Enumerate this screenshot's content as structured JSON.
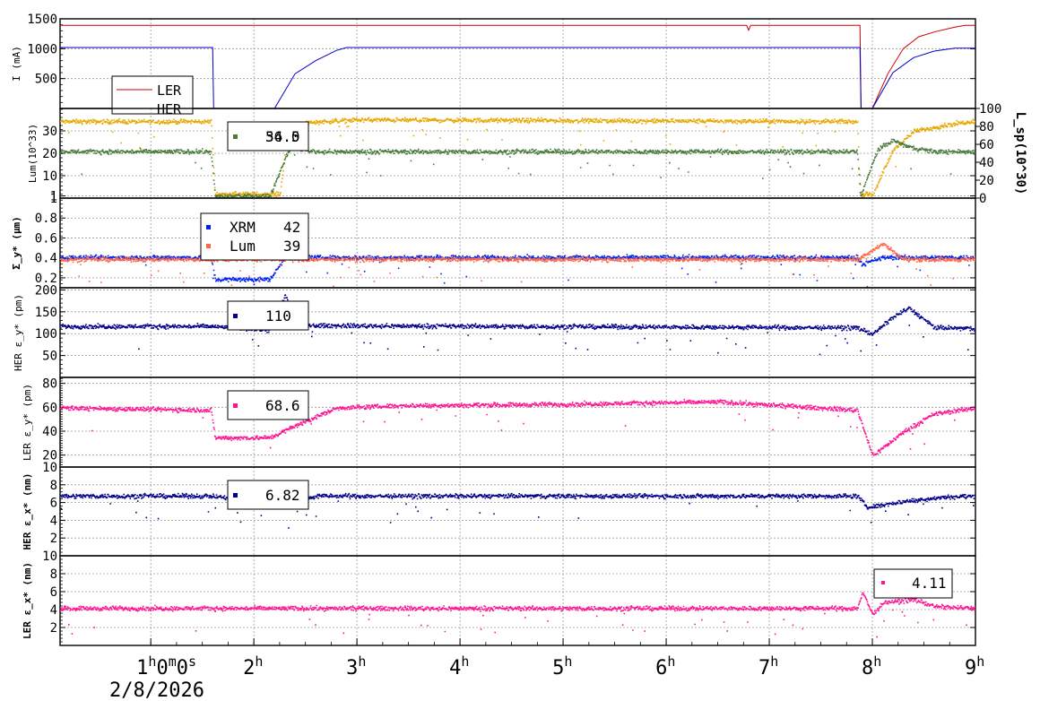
{
  "date_label": "2/8/2026",
  "time_axis": {
    "range_hours": [
      0.12,
      9.0
    ],
    "ticks": [
      {
        "t": 1,
        "base": "1",
        "sups": [
          "h",
          "m",
          "s"
        ],
        "mids": [
          "0",
          "0"
        ]
      },
      {
        "t": 2,
        "base": "2",
        "sups": [
          "h"
        ],
        "mids": []
      },
      {
        "t": 3,
        "base": "3",
        "sups": [
          "h"
        ],
        "mids": []
      },
      {
        "t": 4,
        "base": "4",
        "sups": [
          "h"
        ],
        "mids": []
      },
      {
        "t": 5,
        "base": "5",
        "sups": [
          "h"
        ],
        "mids": []
      },
      {
        "t": 6,
        "base": "6",
        "sups": [
          "h"
        ],
        "mids": []
      },
      {
        "t": 7,
        "base": "7",
        "sups": [
          "h"
        ],
        "mids": []
      },
      {
        "t": 8,
        "base": "8",
        "sups": [
          "h"
        ],
        "mids": []
      },
      {
        "t": 9,
        "base": "9",
        "sups": [
          "h"
        ],
        "mids": []
      }
    ]
  },
  "colors": {
    "ler_current": "#cc0000",
    "her_current": "#0000cc",
    "lum_yellow": "#e6a800",
    "lum_green": "#4a7a3a",
    "xrm": "#0022ee",
    "lum_sigma": "#ff6644",
    "her_emit": "#000088",
    "ler_emit": "#ff1493"
  },
  "chart_data": [
    {
      "type": "line",
      "ylabel": "I (mA)",
      "ylim": [
        0,
        1500
      ],
      "yticks": [
        500,
        1000,
        1500
      ],
      "legend": {
        "placement": "left",
        "entries": [
          {
            "label": "LER",
            "color": "#cc0000"
          },
          {
            "label": "HER",
            "color": "#0000cc"
          }
        ]
      },
      "series": [
        {
          "name": "LER",
          "color": "#cc0000",
          "points": [
            [
              0.12,
              1390
            ],
            [
              6.78,
              1390
            ],
            [
              6.8,
              1310
            ],
            [
              6.82,
              1390
            ],
            [
              7.88,
              1390
            ],
            [
              7.89,
              0
            ],
            [
              8.0,
              0
            ],
            [
              8.15,
              580
            ],
            [
              8.3,
              1000
            ],
            [
              8.45,
              1200
            ],
            [
              8.6,
              1280
            ],
            [
              8.8,
              1360
            ],
            [
              8.9,
              1390
            ],
            [
              9.0,
              1390
            ]
          ]
        },
        {
          "name": "HER",
          "color": "#0000cc",
          "points": [
            [
              0.12,
              1020
            ],
            [
              1.6,
              1020
            ],
            [
              1.61,
              0
            ],
            [
              2.2,
              0
            ],
            [
              2.4,
              580
            ],
            [
              2.6,
              800
            ],
            [
              2.8,
              970
            ],
            [
              2.9,
              1020
            ],
            [
              7.88,
              1020
            ],
            [
              7.89,
              0
            ],
            [
              8.0,
              0
            ],
            [
              8.2,
              600
            ],
            [
              8.4,
              850
            ],
            [
              8.6,
              960
            ],
            [
              8.8,
              1010
            ],
            [
              9.0,
              1010
            ]
          ]
        }
      ]
    },
    {
      "type": "scatter",
      "ylabel": "Lum(10^33)",
      "ylim": [
        0,
        40
      ],
      "yticks": [
        1,
        10,
        20,
        30
      ],
      "y2label": "L_sp(10^30)",
      "y2lim": [
        0,
        100
      ],
      "y2ticks": [
        0,
        20,
        40,
        60,
        80,
        100
      ],
      "legend": {
        "placement": "top-left",
        "entries": [
          {
            "label": "56.0",
            "color": "#e6a800"
          },
          {
            "label": "34.5",
            "color": "#4a7a3a"
          }
        ]
      },
      "series": [
        {
          "name": "",
          "color": "#e6a800",
          "axis": "right",
          "points": [
            [
              0.12,
              86
            ],
            [
              1.58,
              86
            ],
            [
              1.62,
              5
            ],
            [
              2.25,
              5
            ],
            [
              2.32,
              75
            ],
            [
              2.5,
              85
            ],
            [
              3.0,
              88
            ],
            [
              7.85,
              86
            ],
            [
              7.88,
              5
            ],
            [
              8.0,
              5
            ],
            [
              8.2,
              55
            ],
            [
              8.4,
              75
            ],
            [
              8.7,
              82
            ],
            [
              9.0,
              87
            ]
          ]
        },
        {
          "name": "",
          "color": "#4a7a3a",
          "axis": "left",
          "points": [
            [
              0.12,
              21
            ],
            [
              1.58,
              21
            ],
            [
              1.62,
              1
            ],
            [
              2.15,
              1
            ],
            [
              2.3,
              18
            ],
            [
              2.35,
              23
            ],
            [
              2.6,
              21
            ],
            [
              7.85,
              21
            ],
            [
              7.88,
              1
            ],
            [
              8.05,
              22
            ],
            [
              8.2,
              26
            ],
            [
              8.35,
              23
            ],
            [
              8.6,
              21
            ],
            [
              9.0,
              21
            ]
          ]
        }
      ]
    },
    {
      "type": "scatter",
      "ylabel": "Σ_y* (μm)",
      "ylim": [
        0.1,
        1.0
      ],
      "yticks": [
        0.2,
        0.4,
        0.6,
        0.8,
        1.0
      ],
      "legend": {
        "placement": "top-left",
        "entries": [
          {
            "label": "XRM",
            "value": "42",
            "color": "#0022ee"
          },
          {
            "label": "Lum",
            "value": "39",
            "color": "#ff6644"
          }
        ]
      },
      "series": [
        {
          "name": "XRM",
          "color": "#0022ee",
          "points": [
            [
              0.12,
              0.41
            ],
            [
              1.58,
              0.41
            ],
            [
              1.62,
              0.19
            ],
            [
              2.15,
              0.19
            ],
            [
              2.3,
              0.41
            ],
            [
              7.85,
              0.41
            ],
            [
              7.9,
              0.34
            ],
            [
              8.1,
              0.41
            ],
            [
              9.0,
              0.41
            ]
          ]
        },
        {
          "name": "Lum",
          "color": "#ff6644",
          "points": [
            [
              0.12,
              0.39
            ],
            [
              1.58,
              0.39
            ],
            [
              2.3,
              0.39
            ],
            [
              7.85,
              0.39
            ],
            [
              8.1,
              0.55
            ],
            [
              8.3,
              0.39
            ],
            [
              9.0,
              0.39
            ]
          ]
        }
      ]
    },
    {
      "type": "scatter",
      "ylabel": "HER ε_y* (pm)",
      "ylim": [
        0,
        205
      ],
      "yticks": [
        50,
        100,
        150,
        200
      ],
      "legend": {
        "placement": "top-left",
        "entries": [
          {
            "label": "110",
            "color": "#000088"
          }
        ]
      },
      "series": [
        {
          "name": "",
          "color": "#000088",
          "points": [
            [
              0.12,
              118
            ],
            [
              1.58,
              118
            ],
            [
              2.15,
              110
            ],
            [
              2.25,
              160
            ],
            [
              2.3,
              190
            ],
            [
              2.4,
              120
            ],
            [
              7.85,
              115
            ],
            [
              8.0,
              100
            ],
            [
              8.2,
              140
            ],
            [
              8.35,
              160
            ],
            [
              8.6,
              115
            ],
            [
              9.0,
              113
            ]
          ]
        }
      ]
    },
    {
      "type": "scatter",
      "ylabel": "LER ε_y* (pm)",
      "ylim": [
        10,
        85
      ],
      "yticks": [
        10,
        20,
        40,
        60,
        80
      ],
      "legend": {
        "placement": "top-left",
        "entries": [
          {
            "label": "68.6",
            "color": "#ff1493"
          }
        ]
      },
      "series": [
        {
          "name": "",
          "color": "#ff1493",
          "points": [
            [
              0.12,
              60
            ],
            [
              1.58,
              58
            ],
            [
              1.62,
              35
            ],
            [
              2.15,
              35
            ],
            [
              2.4,
              45
            ],
            [
              2.8,
              60
            ],
            [
              3.5,
              62
            ],
            [
              5.0,
              63
            ],
            [
              6.5,
              65
            ],
            [
              7.85,
              58
            ],
            [
              8.0,
              20
            ],
            [
              8.3,
              40
            ],
            [
              8.6,
              55
            ],
            [
              9.0,
              60
            ]
          ]
        }
      ]
    },
    {
      "type": "scatter",
      "ylabel": "HER ε_x* (nm)",
      "ylim": [
        0,
        10
      ],
      "yticks": [
        2,
        4,
        6,
        8
      ],
      "legend": {
        "placement": "top-left",
        "entries": [
          {
            "label": "6.82",
            "color": "#000088"
          }
        ]
      },
      "series": [
        {
          "name": "",
          "color": "#000088",
          "points": [
            [
              0.12,
              6.8
            ],
            [
              1.58,
              6.8
            ],
            [
              2.15,
              6.0
            ],
            [
              2.3,
              6.0
            ],
            [
              2.6,
              6.8
            ],
            [
              7.85,
              6.8
            ],
            [
              7.95,
              5.5
            ],
            [
              8.3,
              6.2
            ],
            [
              8.7,
              6.7
            ],
            [
              9.0,
              6.8
            ]
          ]
        }
      ]
    },
    {
      "type": "scatter",
      "ylabel": "LER ε_x* (nm)",
      "ylim": [
        0,
        10
      ],
      "yticks": [
        2,
        4,
        6,
        8,
        10
      ],
      "legend": {
        "placement": "top-right",
        "entries": [
          {
            "label": "4.11",
            "color": "#ff1493"
          }
        ]
      },
      "series": [
        {
          "name": "",
          "color": "#ff1493",
          "points": [
            [
              0.12,
              4.2
            ],
            [
              7.85,
              4.2
            ],
            [
              7.9,
              6.0
            ],
            [
              8.0,
              3.5
            ],
            [
              8.1,
              4.8
            ],
            [
              8.4,
              5.2
            ],
            [
              8.6,
              4.4
            ],
            [
              9.0,
              4.2
            ]
          ]
        }
      ]
    }
  ]
}
